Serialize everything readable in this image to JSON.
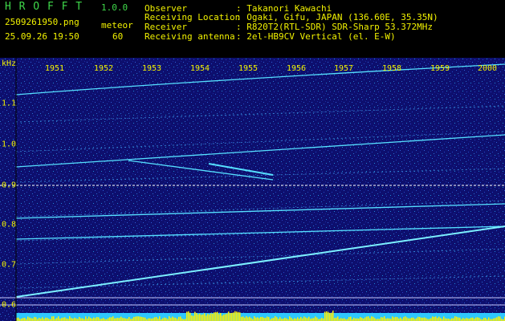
{
  "header": {
    "app_title": "H R O F F T",
    "version": "1.0.0",
    "filename": "2509261950.png",
    "datetime": "25.09.26 19:50",
    "meteor_label": "meteor",
    "meteor_count": "60",
    "rows": [
      {
        "key": "Observer",
        "value": ": Takanori Kawachi"
      },
      {
        "key": "Receiving Location",
        "value": ": Ogaki, Gifu, JAPAN (136.60E, 35.35N)"
      },
      {
        "key": "Receiver",
        "value": ": R820T2(RTL-SDR) SDR-Sharp 53.372MHz"
      },
      {
        "key": "Receiving antenna",
        "value": ": 2el-HB9CV Vertical (el. E-W)"
      }
    ]
  },
  "spectrogram": {
    "y_unit": "kHz",
    "x_ticks": [
      "1951",
      "1952",
      "1953",
      "1954",
      "1955",
      "1956",
      "1957",
      "1958",
      "1959",
      "2000"
    ],
    "y_ticks": [
      "1.1",
      "1.0",
      "0.9",
      "0.8",
      "0.7",
      "0.6"
    ],
    "colors": {
      "background": "#0d0f6e",
      "trace": "#56e0ff",
      "bright": "#ffffff",
      "signal_bar": "#ffee00",
      "signal_base": "#2ec8ff",
      "axis": "#f2f200"
    }
  }
}
